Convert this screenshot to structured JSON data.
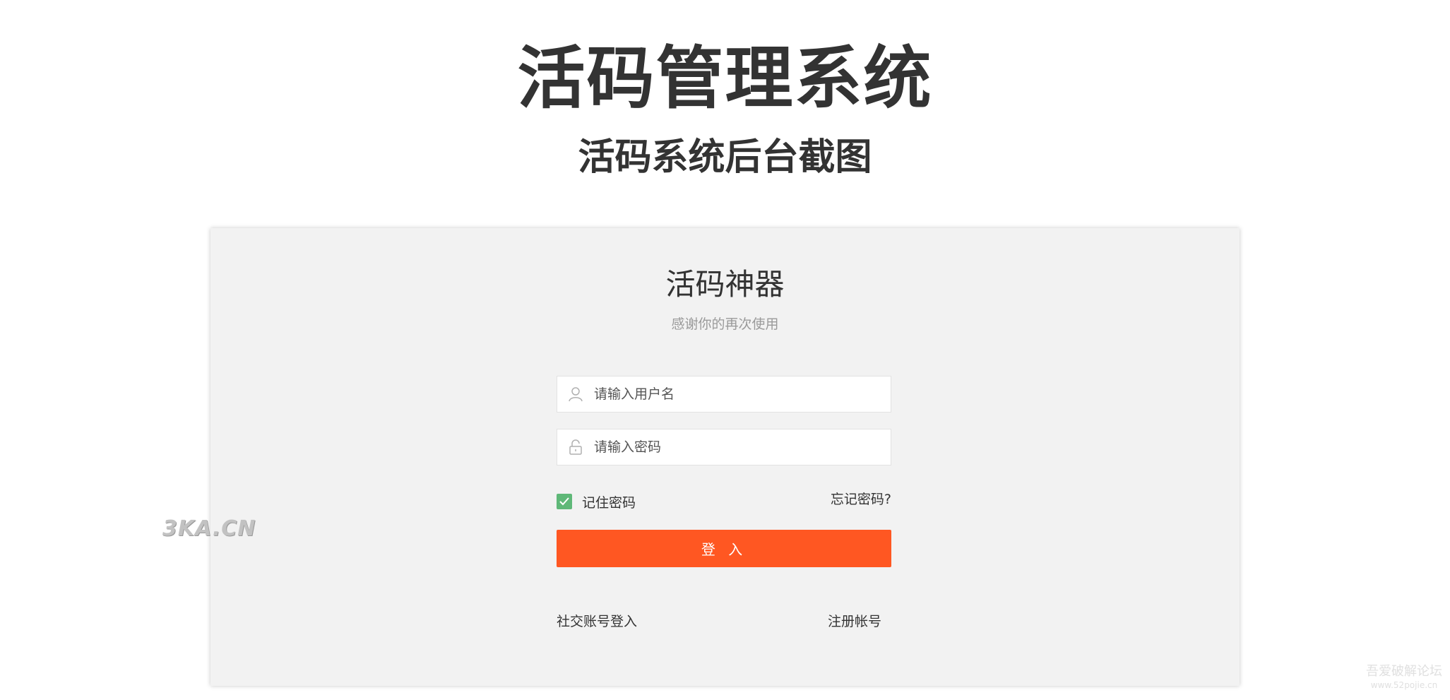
{
  "header": {
    "title": "活码管理系统",
    "subtitle": "活码系统后台截图"
  },
  "login_card": {
    "title": "活码神器",
    "subtitle": "感谢你的再次使用",
    "username": {
      "placeholder": "请输入用户名",
      "value": "",
      "icon": "user-icon"
    },
    "password": {
      "placeholder": "请输入密码",
      "value": "",
      "icon": "lock-icon"
    },
    "remember": {
      "label": "记住密码",
      "checked": true
    },
    "forgot_label": "忘记密码?",
    "login_label": "登 入",
    "social_label": "社交账号登入",
    "register_label": "注册帐号"
  },
  "watermarks": {
    "left": "3KA.CN",
    "right_line1": "吾爱破解论坛",
    "right_line2": "www.52pojie.cn"
  },
  "colors": {
    "primary_button": "#ff5722",
    "checkbox": "#5fb878",
    "card_background": "#f2f2f2"
  }
}
